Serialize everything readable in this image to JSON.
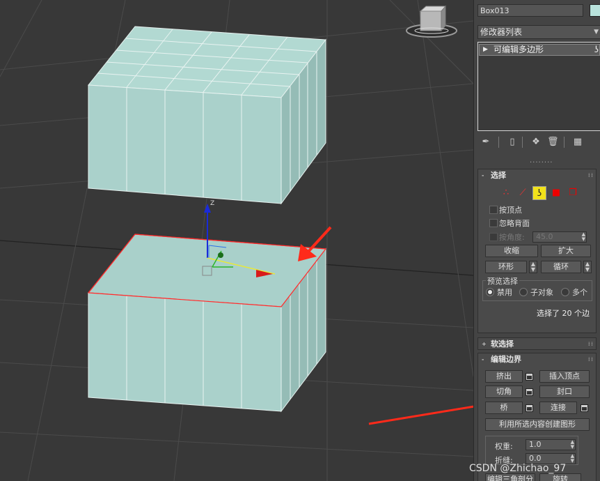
{
  "viewport": {
    "gizmo_axis_z": "Z",
    "colors": {
      "box_fill": "#aad1cb",
      "box_side": "#94bdb7",
      "edge_highlight": "#ff2a2a",
      "arrow": "#ff2a1a",
      "grid": "#4a4a4a"
    }
  },
  "panel": {
    "object_name": "Box013",
    "object_color": "#b9e3dc",
    "modifier_list_label": "修改器列表",
    "modifier_stack": [
      {
        "label": "可编辑多边形"
      }
    ],
    "toolbar_icons": [
      "pin-stack-icon",
      "show-end-result-icon",
      "make-unique-icon",
      "remove-modifier-icon",
      "configure-modifier-sets-icon"
    ],
    "separator_dots": "········"
  },
  "selection": {
    "title": "选择",
    "sign": "-",
    "subobject_icons": [
      "vertex-icon",
      "edge-icon",
      "border-icon",
      "polygon-icon",
      "element-icon"
    ],
    "active_subobject": "border-icon",
    "by_vertex": "按顶点",
    "ignore_backfacing": "忽略背面",
    "by_angle": "按角度:",
    "angle_value": "45.0",
    "shrink": "收缩",
    "grow": "扩大",
    "ring": "环形",
    "loop": "循环",
    "preview_group": "预览选择",
    "preview_options": [
      "禁用",
      "子对象",
      "多个"
    ],
    "preview_selected": "禁用",
    "status": "选择了 20 个边"
  },
  "soft_selection": {
    "title": "软选择",
    "sign": "+"
  },
  "edit_borders": {
    "title": "编辑边界",
    "sign": "-",
    "extrude": "挤出",
    "insert_vertex": "插入顶点",
    "chamfer": "切角",
    "cap": "封口",
    "bridge": "桥",
    "connect": "连接",
    "create_shape": "利用所选内容创建图形",
    "weight_label": "权重:",
    "weight_value": "1.0",
    "crease_label": "折缝:",
    "crease_value": "0.0",
    "bottom_left": "编辑三角剖分",
    "bottom_right": "旋转"
  },
  "watermark": "CSDN @Zhichao_97"
}
